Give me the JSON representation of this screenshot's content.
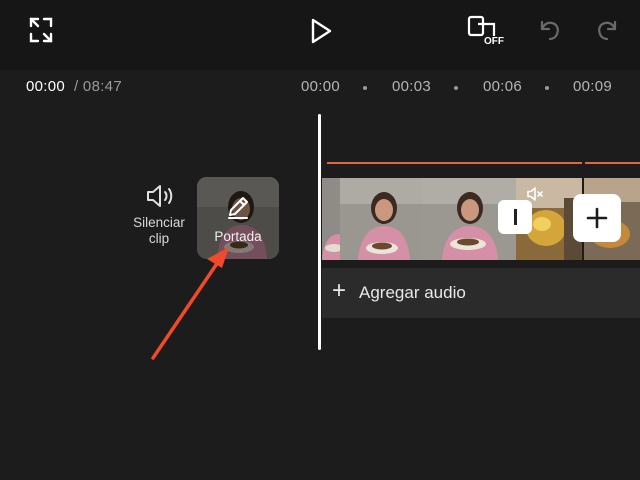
{
  "toolbar": {
    "fullscreen_icon": "expand-icon",
    "play_icon": "play-icon",
    "hd_badge": "OFF",
    "undo_icon": "undo-icon",
    "redo_icon": "redo-icon"
  },
  "time": {
    "current": "00:00",
    "total": "/ 08:47"
  },
  "ruler": {
    "labels": [
      "00:00",
      "00:03",
      "00:06",
      "00:09"
    ]
  },
  "side_tools": {
    "mute_label": "Silenciar clip",
    "mute_icon": "speaker-icon",
    "cover_label": "Portada",
    "cover_icon": "pencil-icon"
  },
  "timeline": {
    "add_audio_label": "Agregar audio",
    "accent_color": "#e0683a"
  },
  "annotation": {
    "arrow_color": "#f04a2a"
  }
}
